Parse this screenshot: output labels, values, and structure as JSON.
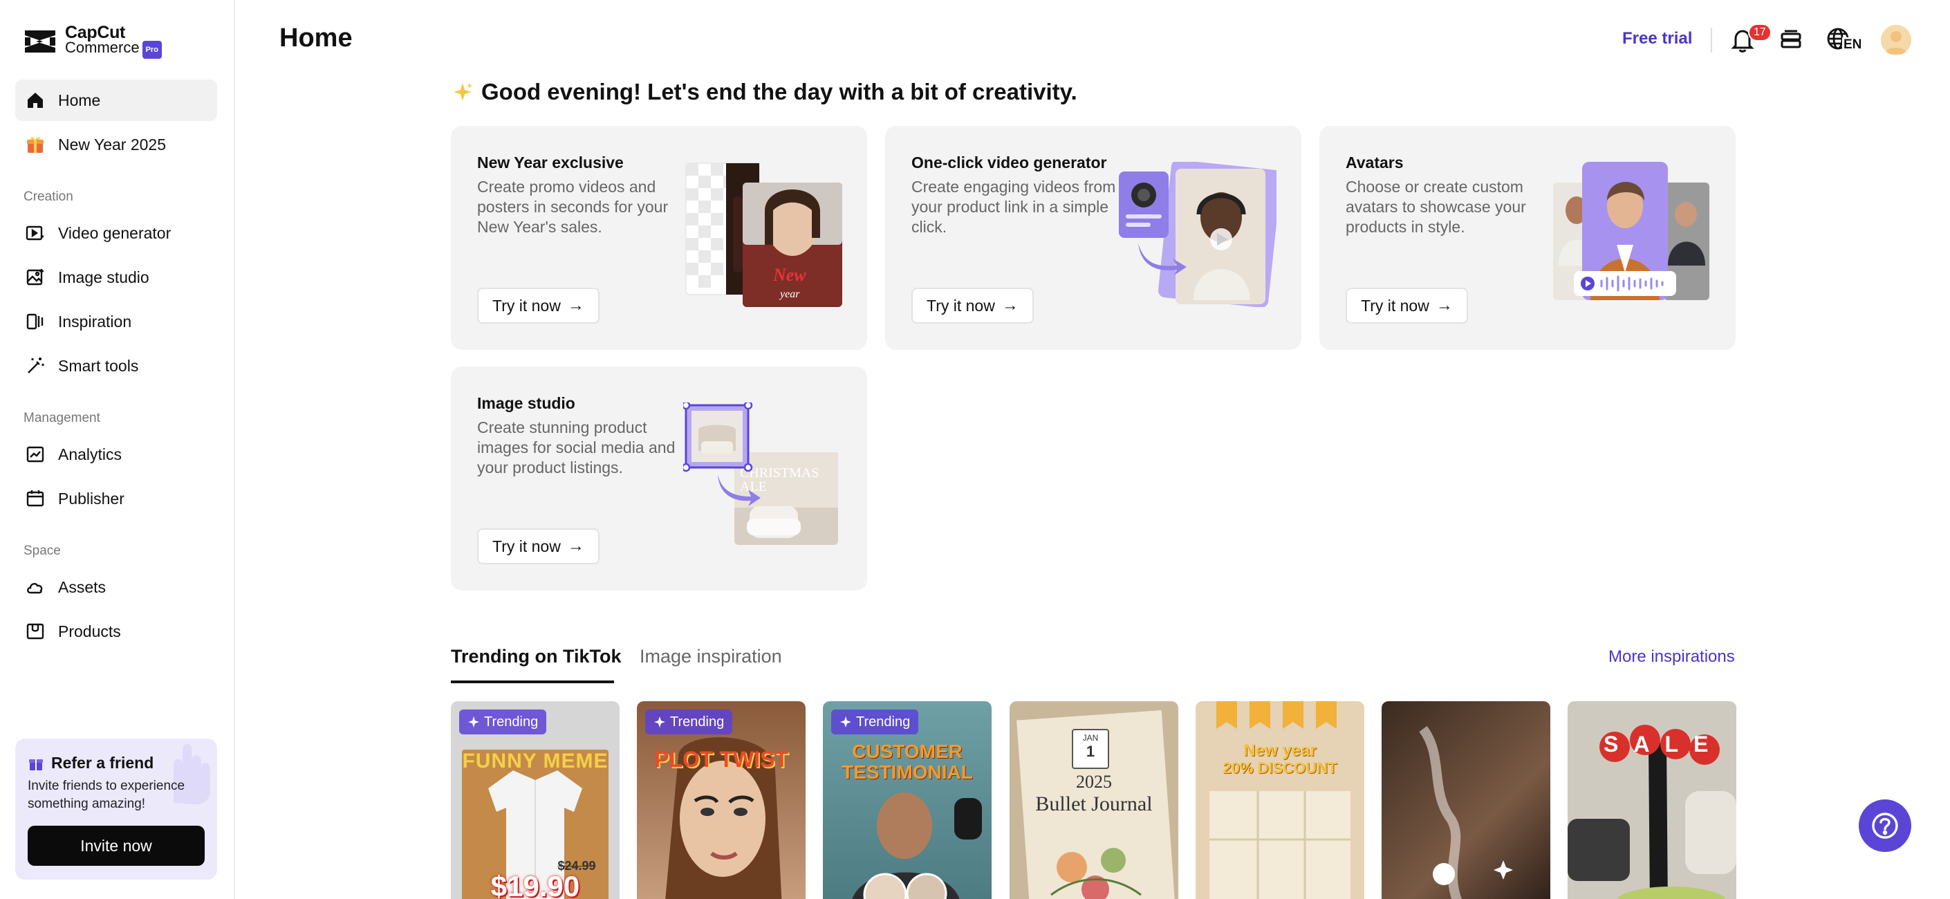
{
  "app": {
    "logo_line1": "CapCut",
    "logo_line2": "Commerce",
    "logo_badge": "Pro"
  },
  "sidebar": {
    "top_items": [
      {
        "label": "Home",
        "icon": "home-icon",
        "active": true
      },
      {
        "label": "New Year 2025",
        "icon": "gift-icon",
        "active": false
      }
    ],
    "sections": [
      {
        "title": "Creation",
        "items": [
          {
            "label": "Video generator",
            "icon": "video-generator-icon"
          },
          {
            "label": "Image studio",
            "icon": "image-studio-icon"
          },
          {
            "label": "Inspiration",
            "icon": "inspiration-icon"
          },
          {
            "label": "Smart tools",
            "icon": "magic-wand-icon"
          }
        ]
      },
      {
        "title": "Management",
        "items": [
          {
            "label": "Analytics",
            "icon": "analytics-icon"
          },
          {
            "label": "Publisher",
            "icon": "calendar-icon"
          }
        ]
      },
      {
        "title": "Space",
        "items": [
          {
            "label": "Assets",
            "icon": "cloud-icon"
          },
          {
            "label": "Products",
            "icon": "product-box-icon"
          }
        ]
      }
    ],
    "refer": {
      "title": "Refer a friend",
      "description": "Invite friends to experience something amazing!",
      "button": "Invite now"
    }
  },
  "header": {
    "title": "Home",
    "free_trial": "Free trial",
    "notification_count": "17",
    "language": "EN"
  },
  "greeting": "Good evening! Let's end the day with a bit of creativity.",
  "cards": [
    {
      "title": "New Year exclusive",
      "description": "Create promo videos and posters in seconds for your New Year's sales.",
      "button": "Try it now",
      "art_text_1": "New",
      "art_text_2": "year"
    },
    {
      "title": "One-click video generator",
      "description": "Create engaging videos from your product link in a simple click.",
      "button": "Try it now"
    },
    {
      "title": "Avatars",
      "description": "Choose or create custom avatars to showcase your products in style.",
      "button": "Try it now"
    },
    {
      "title": "Image studio",
      "description": "Create stunning product images for social media and your product listings.",
      "button": "Try it now",
      "art_text_1": "CHRISTMAS",
      "art_text_2": "ALE"
    }
  ],
  "tabs": [
    {
      "label": "Trending on TikTok",
      "active": true
    },
    {
      "label": "Image inspiration",
      "active": false
    }
  ],
  "more_inspirations": "More inspirations",
  "thumbnails": [
    {
      "badge": "Trending",
      "line1": "FUNNY MEME",
      "line2": "$24.99",
      "line3": "$19.90"
    },
    {
      "badge": "Trending",
      "line1": "PLOT TWIST"
    },
    {
      "badge": "Trending",
      "line1": "CUSTOMER",
      "line2": "TESTIMONIAL"
    },
    {
      "line0": "JAN",
      "line00": "1",
      "line1": "2025",
      "line2": "Bullet Journal"
    },
    {
      "line1": "New year",
      "line2": "20% DISCOUNT"
    },
    {},
    {
      "line1": "SALE"
    }
  ],
  "colors": {
    "accent": "#5b45d6",
    "link": "#4a35c9",
    "card_bg": "#f3f3f3",
    "badge_red": "#e5322d"
  }
}
